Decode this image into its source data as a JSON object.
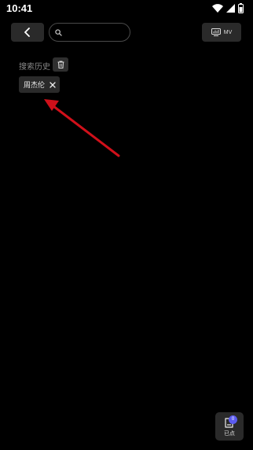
{
  "status_bar": {
    "time": "10:41",
    "icons": [
      "wifi-icon",
      "signal-icon",
      "battery-icon"
    ]
  },
  "header": {
    "back_icon": "chevron-left-icon",
    "search": {
      "value": "",
      "placeholder": "",
      "icon": "search-icon"
    },
    "mv_button": {
      "label": "MV",
      "icon": "video-chart-icon"
    }
  },
  "history": {
    "label": "搜索历史",
    "clear_icon": "trash-icon",
    "items": [
      {
        "label": "周杰伦",
        "remove_icon": "close-icon"
      }
    ]
  },
  "floating_button": {
    "label": "已点",
    "badge": "0",
    "icon": "playlist-icon"
  },
  "colors": {
    "background": "#000000",
    "surface": "#2a2a2a",
    "arrow": "#d0101a",
    "badge": "#5b5bf0"
  }
}
